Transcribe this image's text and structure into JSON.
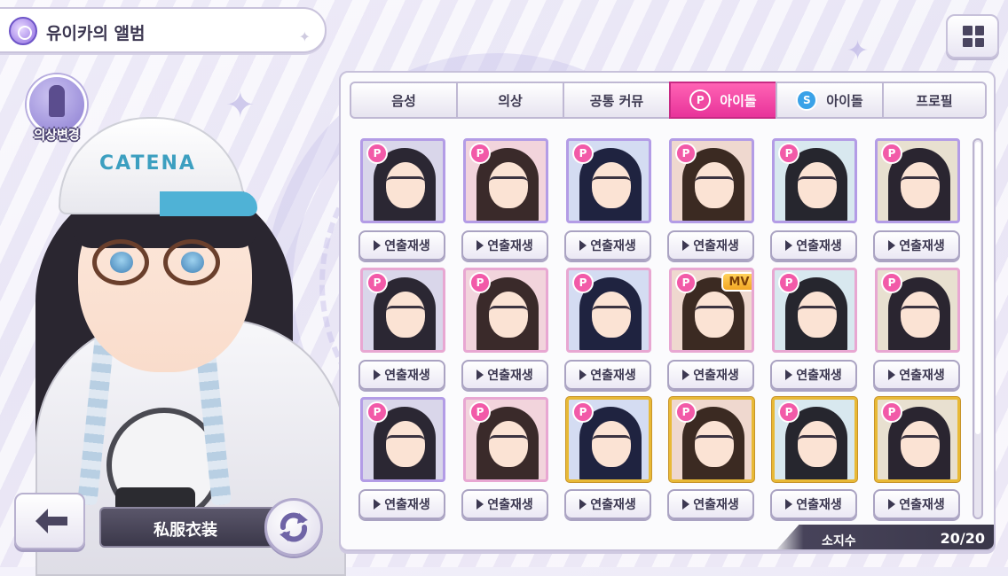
{
  "header": {
    "title": "유이카의 앨범"
  },
  "costume": {
    "label": "의상변경"
  },
  "outfit": {
    "name": "私服衣装"
  },
  "character": {
    "cap_text": "CATENA"
  },
  "tabs": [
    {
      "label": "음성",
      "badge": "",
      "active": false
    },
    {
      "label": "의상",
      "badge": "",
      "active": false
    },
    {
      "label": "공통 커뮤",
      "badge": "",
      "active": false
    },
    {
      "label": "아이돌",
      "badge": "P",
      "active": true
    },
    {
      "label": "아이돌",
      "badge": "S",
      "active": false
    },
    {
      "label": "프로필",
      "badge": "",
      "active": false
    }
  ],
  "cards": [
    {
      "rarity": "purple",
      "badge": "P",
      "mv": "",
      "play_label": "연출재생"
    },
    {
      "rarity": "purple",
      "badge": "P",
      "mv": "",
      "play_label": "연출재생"
    },
    {
      "rarity": "purple",
      "badge": "P",
      "mv": "",
      "play_label": "연출재생"
    },
    {
      "rarity": "purple",
      "badge": "P",
      "mv": "",
      "play_label": "연출재생"
    },
    {
      "rarity": "purple",
      "badge": "P",
      "mv": "",
      "play_label": "연출재생"
    },
    {
      "rarity": "purple",
      "badge": "P",
      "mv": "",
      "play_label": "연출재생"
    },
    {
      "rarity": "pink",
      "badge": "P",
      "mv": "",
      "play_label": "연출재생"
    },
    {
      "rarity": "pink",
      "badge": "P",
      "mv": "",
      "play_label": "연출재생"
    },
    {
      "rarity": "pink",
      "badge": "P",
      "mv": "",
      "play_label": "연출재생"
    },
    {
      "rarity": "pink",
      "badge": "P",
      "mv": "MV",
      "play_label": "연출재생"
    },
    {
      "rarity": "pink",
      "badge": "P",
      "mv": "",
      "play_label": "연출재생"
    },
    {
      "rarity": "pink",
      "badge": "P",
      "mv": "",
      "play_label": "연출재생"
    },
    {
      "rarity": "purple",
      "badge": "P",
      "mv": "",
      "play_label": "연출재생"
    },
    {
      "rarity": "pink",
      "badge": "P",
      "mv": "",
      "play_label": "연출재생"
    },
    {
      "rarity": "gold",
      "badge": "P",
      "mv": "",
      "play_label": "연출재생"
    },
    {
      "rarity": "gold",
      "badge": "P",
      "mv": "",
      "play_label": "연출재생"
    },
    {
      "rarity": "gold",
      "badge": "P",
      "mv": "",
      "play_label": "연출재생"
    },
    {
      "rarity": "gold",
      "badge": "P",
      "mv": "",
      "play_label": "연출재생"
    }
  ],
  "count": {
    "label": "소지수",
    "value": "20/20"
  },
  "colors": {
    "accent_pink": "#e8339a",
    "s_blue": "#3aa2e8",
    "panel_border": "#c7c1da"
  },
  "icons": {
    "title": "album-icon",
    "menu": "grid-menu-icon",
    "back": "back-arrow-icon",
    "refresh": "refresh-icon",
    "costume": "mannequin-icon"
  }
}
